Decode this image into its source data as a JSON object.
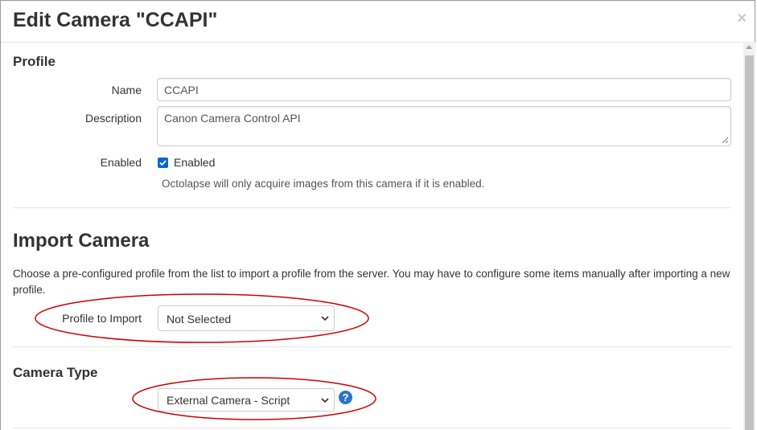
{
  "modal": {
    "title": "Edit Camera \"CCAPI\"",
    "close_symbol": "×"
  },
  "profile": {
    "heading": "Profile",
    "name_label": "Name",
    "name_value": "CCAPI",
    "description_label": "Description",
    "description_value": "Canon Camera Control API",
    "enabled_label": "Enabled",
    "enabled_checkbox_label": "Enabled",
    "enabled_checked": true,
    "enabled_help": "Octolapse will only acquire images from this camera if it is enabled."
  },
  "import_camera": {
    "heading": "Import Camera",
    "description": "Choose a pre-configured profile from the list to import a profile from the server. You may have to configure some items manually after importing a new profile.",
    "profile_to_import_label": "Profile to Import",
    "profile_to_import_selected": "Not Selected"
  },
  "camera_type": {
    "heading": "Camera Type",
    "selected": "External Camera - Script",
    "help_symbol": "?"
  },
  "colors": {
    "accent": "#2a73c9",
    "checkbox": "#0a66d8",
    "annotation": "#cc0000"
  },
  "icons": {
    "close": "close-icon",
    "checkbox": "checkmark-icon",
    "select": "chevron-down-icon",
    "help": "question-circle-icon"
  }
}
